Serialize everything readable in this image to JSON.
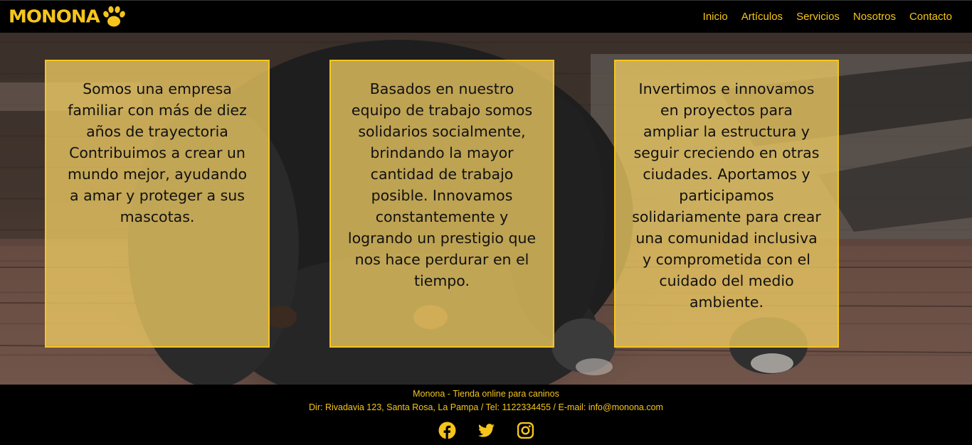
{
  "brand": {
    "name": "MONONA",
    "icon": "paw-icon",
    "color": "#f6c51b"
  },
  "nav": {
    "items": [
      {
        "label": "Inicio"
      },
      {
        "label": "Artículos"
      },
      {
        "label": "Servicios"
      },
      {
        "label": "Nosotros"
      },
      {
        "label": "Contacto"
      }
    ]
  },
  "cards": [
    {
      "text": "Somos una empresa familiar con más de diez años de trayectoria Contribuimos a crear un mundo mejor, ayudando a amar y proteger a sus mascotas."
    },
    {
      "text": "Basados en nuestro equipo de trabajo somos solidarios socialmente, brindando la mayor cantidad de trabajo posible. Innovamos constantemente y logrando un prestigio que nos hace perdurar en el tiempo."
    },
    {
      "text": "Invertimos e innovamos en proyectos para ampliar la estructura y seguir creciendo en otras ciudades. Aportamos y participamos solidariamente para crear una comunidad inclusiva y comprometida con el cuidado del medio ambiente."
    }
  ],
  "footer": {
    "title": "Monona - Tienda online para caninos",
    "contact": "Dir: Rivadavia 123, Santa Rosa, La Pampa / Tel: 1122334455 / E-mail: info@monona.com",
    "social": [
      {
        "icon": "facebook-icon"
      },
      {
        "icon": "twitter-icon"
      },
      {
        "icon": "instagram-icon"
      }
    ]
  },
  "colors": {
    "accent": "#f6c51b",
    "card_bg": "rgba(240,205,100,0.76)",
    "background": "#000000"
  }
}
